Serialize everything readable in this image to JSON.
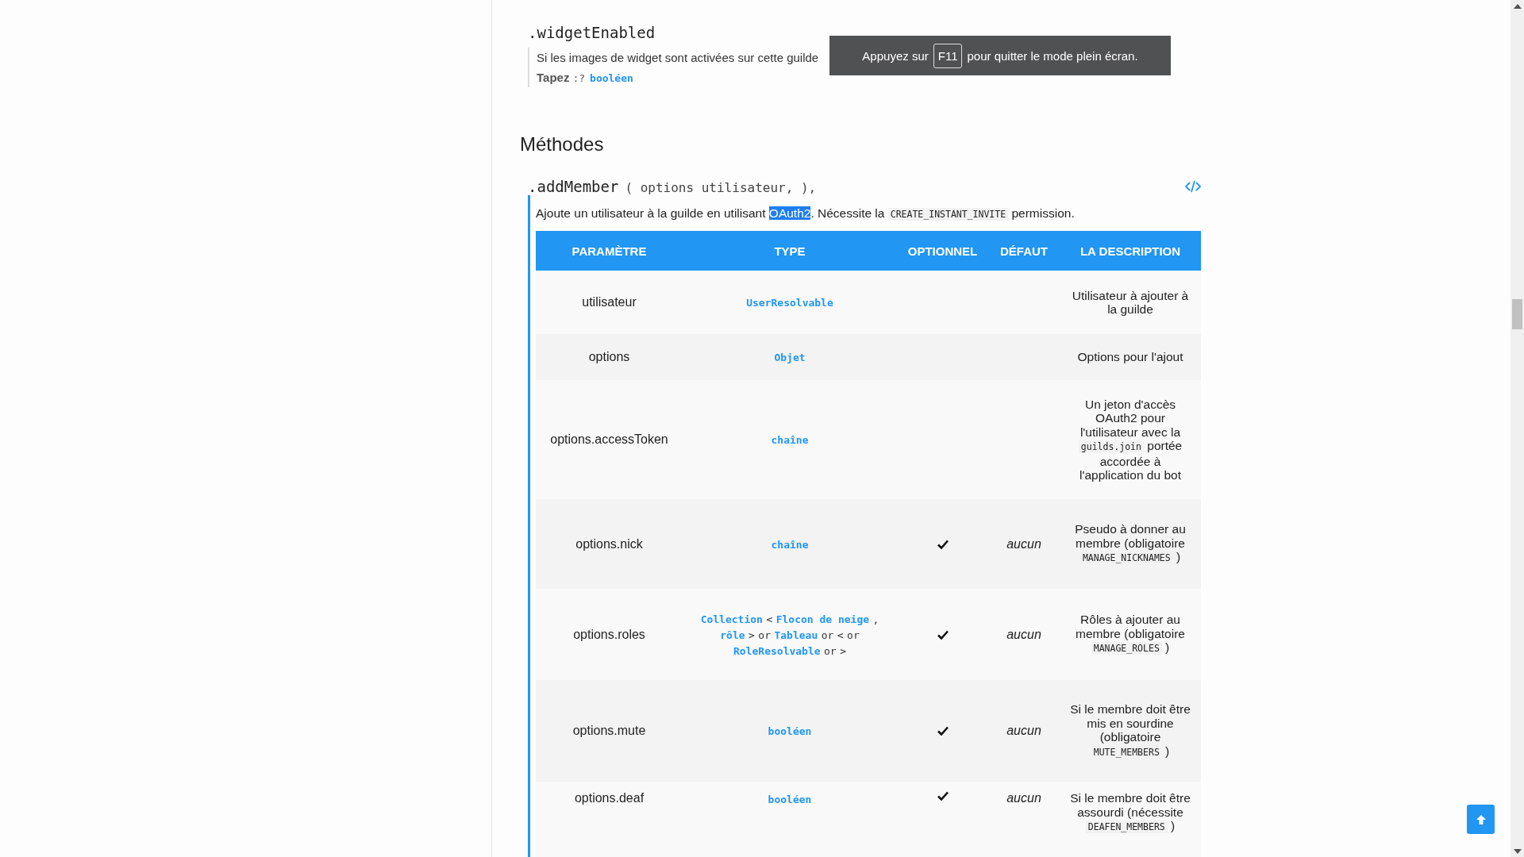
{
  "property": {
    "name": ".widgetEnabled",
    "description": "Si les images de widget sont activées sur cette guilde",
    "type_label": "Tapez",
    "type_sep": ":?",
    "type_value": "booléen"
  },
  "section_title": "Méthodes",
  "method": {
    "name": ".addMember",
    "signature": "( options utilisateur, ),",
    "description": [
      {
        "kind": "text",
        "text": "Ajoute un utilisateur à la guilde en utilisant "
      },
      {
        "kind": "highlight",
        "text": "OAuth2"
      },
      {
        "kind": "text",
        "text": ". Nécessite la "
      },
      {
        "kind": "code",
        "text": "CREATE_INSTANT_INVITE"
      },
      {
        "kind": "text",
        "text": " permission."
      }
    ]
  },
  "table": {
    "columns": [
      "PARAMÈTRE",
      "TYPE",
      "OPTIONNEL",
      "DÉFAUT",
      "LA DESCRIPTION"
    ],
    "rows": [
      {
        "parameter": "utilisateur",
        "type": [
          {
            "kind": "link",
            "text": "UserResolvable"
          }
        ],
        "optional": false,
        "description": [
          {
            "kind": "text",
            "text": "Utilisateur à ajouter à la guilde"
          }
        ]
      },
      {
        "parameter": "options",
        "type": [
          {
            "kind": "link",
            "text": "Objet"
          }
        ],
        "optional": false,
        "description": [
          {
            "kind": "text",
            "text": "Options pour l'ajout"
          }
        ]
      },
      {
        "parameter": "options.accessToken",
        "type": [
          {
            "kind": "link",
            "text": "chaîne"
          }
        ],
        "optional": false,
        "description": [
          {
            "kind": "text",
            "text": "Un jeton d'accès OAuth2 pour l'utilisateur avec la "
          },
          {
            "kind": "code",
            "text": "guilds.join"
          },
          {
            "kind": "text",
            "text": " portée accordée à l'application du bot"
          }
        ]
      },
      {
        "parameter": "options.nick",
        "type": [
          {
            "kind": "link",
            "text": "chaîne"
          }
        ],
        "optional": true,
        "default": "aucun",
        "description": [
          {
            "kind": "text",
            "text": "Pseudo à donner au membre (obligatoire "
          },
          {
            "kind": "code",
            "text": "MANAGE_NICKNAMES"
          },
          {
            "kind": "text",
            "text": " )"
          }
        ]
      },
      {
        "parameter": "options.roles",
        "type": [
          {
            "kind": "link",
            "text": "Collection"
          },
          {
            "kind": "symbol",
            "text": "<"
          },
          {
            "kind": "link",
            "text": "Flocon de neige"
          },
          {
            "kind": "symbol",
            "text": ","
          },
          {
            "kind": "link",
            "text": "rôle"
          },
          {
            "kind": "symbol",
            "text": ">"
          },
          {
            "kind": "symbol",
            "text": "or"
          },
          {
            "kind": "link",
            "text": "Tableau"
          },
          {
            "kind": "symbol",
            "text": "or"
          },
          {
            "kind": "symbol",
            "text": "<"
          },
          {
            "kind": "symbol",
            "text": "or"
          },
          {
            "kind": "link",
            "text": "RoleResolvable"
          },
          {
            "kind": "symbol",
            "text": "or"
          },
          {
            "kind": "symbol",
            "text": ">"
          }
        ],
        "optional": true,
        "default": "aucun",
        "description": [
          {
            "kind": "text",
            "text": "Rôles à ajouter au membre (obligatoire "
          },
          {
            "kind": "code",
            "text": "MANAGE_ROLES"
          },
          {
            "kind": "text",
            "text": " )"
          }
        ]
      },
      {
        "parameter": "options.mute",
        "type": [
          {
            "kind": "link",
            "text": "booléen"
          }
        ],
        "optional": true,
        "default": "aucun",
        "description": [
          {
            "kind": "text",
            "text": "Si le membre doit être mis en sourdine (obligatoire "
          },
          {
            "kind": "code",
            "text": "MUTE_MEMBERS"
          },
          {
            "kind": "text",
            "text": " )"
          }
        ]
      },
      {
        "parameter": "options.deaf",
        "type": [
          {
            "kind": "link",
            "text": "booléen"
          }
        ],
        "optional": true,
        "default": "aucun",
        "description": [
          {
            "kind": "text",
            "text": "Si le membre doit être assourdi (nécessite "
          },
          {
            "kind": "code",
            "text": "DEAFEN_MEMBERS"
          },
          {
            "kind": "text",
            "text": " )"
          }
        ]
      }
    ]
  },
  "fullscreen_toast": {
    "before": "Appuyez sur",
    "key": "F11",
    "after": "pour quitter le mode plein écran."
  }
}
